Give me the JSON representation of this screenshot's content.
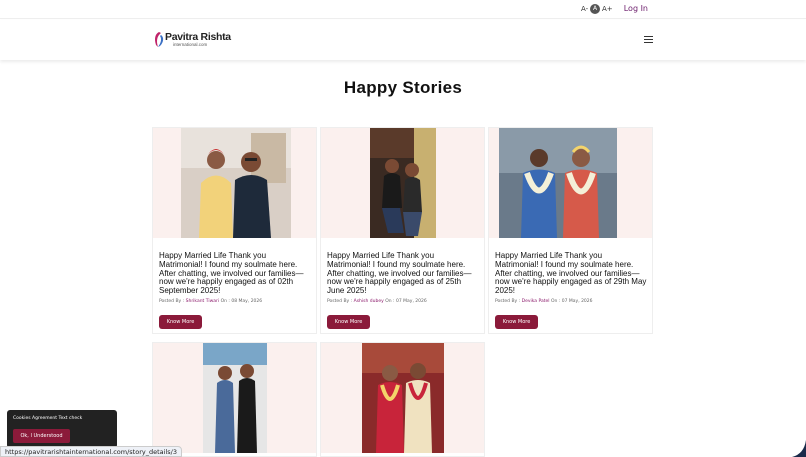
{
  "topbar": {
    "font_decrease": "A-",
    "font_normal": "A",
    "font_increase": "A+",
    "login_label": "Log In"
  },
  "header": {
    "logo_name": "Pavitra Rishta",
    "logo_domain": "international.com",
    "menu_icon": "hamburger-icon"
  },
  "page": {
    "title": "Happy Stories"
  },
  "stories": [
    {
      "text": "Happy Married Life Thank you Matrimonial! I found my soulmate here. After chatting, we involved our families— now we're happily engaged as of 02th September 2025!",
      "posted_by_label": "Posted By :",
      "author": "Shrikant Tiwari",
      "on_label": "On :",
      "date": "08 May, 2026",
      "button_label": "Know More"
    },
    {
      "text": "Happy Married Life Thank you Matrimonial! I found my soulmate here. After chatting, we involved our families— now we're happily engaged as of 25th June 2025!",
      "posted_by_label": "Posted By :",
      "author": "Ashish dubey",
      "on_label": "On :",
      "date": "07 May, 2026",
      "button_label": "Know More"
    },
    {
      "text": "Happy Married Life Thank you Matrimonial! I found my soulmate here. After chatting, we involved our families— now we're happily engaged as of 29th May 2025!",
      "posted_by_label": "Posted By :",
      "author": "Devika Patel",
      "on_label": "On :",
      "date": "07 May, 2026",
      "button_label": "Know More"
    }
  ],
  "cookie_banner": {
    "text": "Cookies Agreement Text check",
    "button_label": "Ok, I Understood"
  },
  "status_url": "https://pavitrarishtainternational.com/story_details/3",
  "colors": {
    "brand": "#8b1a3a",
    "card_bg": "#fbf0ee",
    "login": "#6a1a6a"
  }
}
